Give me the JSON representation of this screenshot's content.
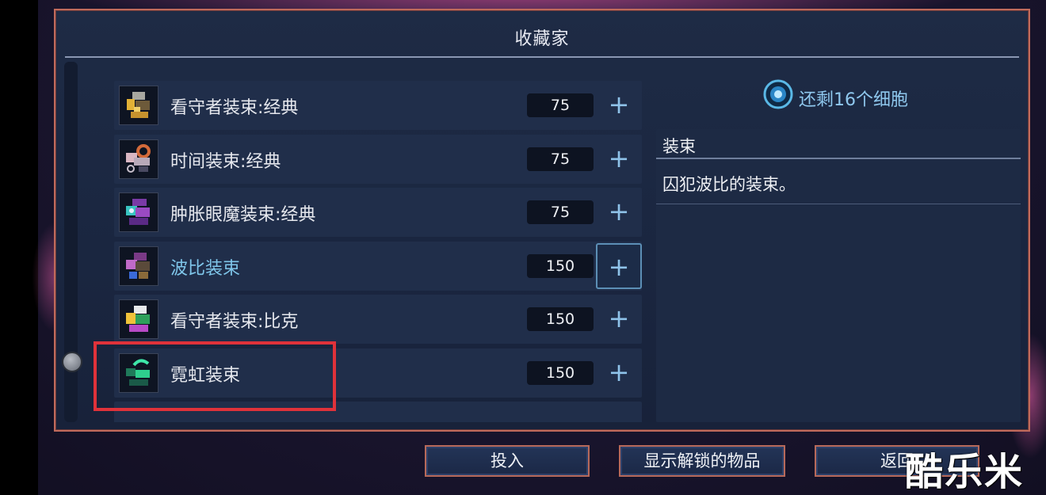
{
  "window": {
    "title": "收藏家"
  },
  "items": [
    {
      "name": "看守者装束:经典",
      "price": "75",
      "selected": false,
      "icon": "outfit-icon-keeper-classic"
    },
    {
      "name": "时间装束:经典",
      "price": "75",
      "selected": false,
      "icon": "outfit-icon-time-classic"
    },
    {
      "name": "肿胀眼魔装束:经典",
      "price": "75",
      "selected": false,
      "icon": "outfit-icon-eye-classic"
    },
    {
      "name": "波比装束",
      "price": "150",
      "selected": true,
      "icon": "outfit-icon-bobby"
    },
    {
      "name": "看守者装束:比克",
      "price": "150",
      "selected": false,
      "icon": "outfit-icon-keeper-beak"
    },
    {
      "name": "霓虹装束",
      "price": "150",
      "selected": false,
      "icon": "outfit-icon-neon"
    }
  ],
  "add_symbol": "+",
  "cells": {
    "text": "还剩16个细胞",
    "icon": "cell-icon"
  },
  "details": {
    "heading": "装束",
    "description": "囚犯波比的装束。"
  },
  "buttons": {
    "invest": "投入",
    "show_unlocked": "显示解锁的物品",
    "back": "返回"
  },
  "watermark": "酷乐米",
  "colors": {
    "accent": "#8fc8ee",
    "selected_text": "#7fc6ea",
    "border": "#c06a5c",
    "annotation": "#e0323a"
  }
}
